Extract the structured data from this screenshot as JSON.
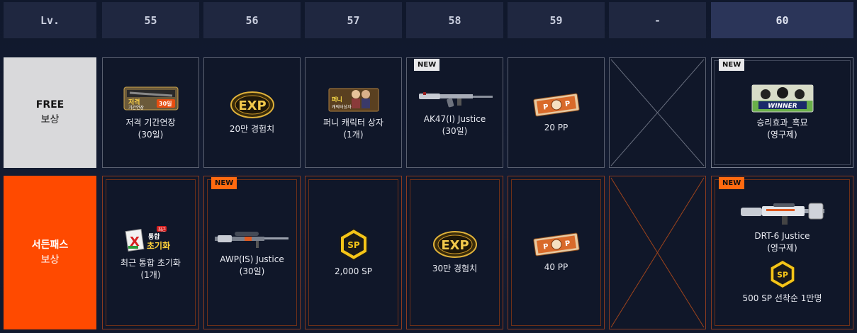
{
  "header": {
    "lv_label": "Lv.",
    "levels": [
      "55",
      "56",
      "57",
      "58",
      "59",
      "-",
      "60"
    ]
  },
  "rows": {
    "free_label_line1": "FREE",
    "free_label_line2": "보상",
    "paid_label_line1": "서든패스",
    "paid_label_line2": "보상"
  },
  "badge_new": "NEW",
  "free_rewards": [
    {
      "icon": "sniper-period-extension-30day-icon",
      "line1": "저격 기간연장",
      "line2": "(30일)",
      "icon_text1": "저격",
      "icon_text2": "기간연장",
      "icon_text3": "30일"
    },
    {
      "icon": "exp-coin-icon",
      "line1": "20만 경험치",
      "line2": "",
      "icon_text1": "EXP"
    },
    {
      "icon": "funny-character-box-icon",
      "line1": "퍼니 캐릭터 상자",
      "line2": "(1개)",
      "icon_text1": "퍼니",
      "icon_text2": "캐릭터상자"
    },
    {
      "icon": "ak47-rifle-icon",
      "line1": "AK47(I) Justice",
      "line2": "(30일)",
      "new": true
    },
    {
      "icon": "pp-ticket-icon",
      "line1": "20 PP",
      "line2": "",
      "icon_text1": "P",
      "icon_text2": "P"
    },
    {
      "icon": "empty-slot-x-icon",
      "line1": "",
      "line2": ""
    },
    {
      "icon": "winner-victory-effect-icon",
      "line1": "승리효과_흑묘",
      "line2": "(영구제)",
      "new": true,
      "icon_text1": "WINNER"
    }
  ],
  "paid_rewards": [
    {
      "icon": "recent-stats-reset-icon",
      "line1": "최근 통합 초기화",
      "line2": "(1개)",
      "icon_text1": "최근",
      "icon_text2": "통합",
      "icon_text3": "초기화"
    },
    {
      "icon": "awp-sniper-rifle-icon",
      "line1": "AWP(IS) Justice",
      "line2": "(30일)",
      "new": true
    },
    {
      "icon": "sp-hexagon-icon",
      "line1": "2,000 SP",
      "line2": "",
      "icon_text1": "SP"
    },
    {
      "icon": "exp-coin-icon",
      "line1": "30만 경험치",
      "line2": "",
      "icon_text1": "EXP"
    },
    {
      "icon": "pp-ticket-icon",
      "line1": "40 PP",
      "line2": "",
      "icon_text1": "P",
      "icon_text2": "P"
    },
    {
      "icon": "empty-slot-x-icon",
      "line1": "",
      "line2": ""
    },
    {
      "icon": "drt6-rifle-icon",
      "line1": "DRT-6 Justice",
      "line2": "(영구제)",
      "new": true,
      "extra_icon_text": "SP",
      "extra_line": "500 SP  선착순 1만명"
    }
  ],
  "colors": {
    "accent_orange": "#ff4a00",
    "free_label_bg": "#d9d9db",
    "gold": "#e0b23a"
  }
}
